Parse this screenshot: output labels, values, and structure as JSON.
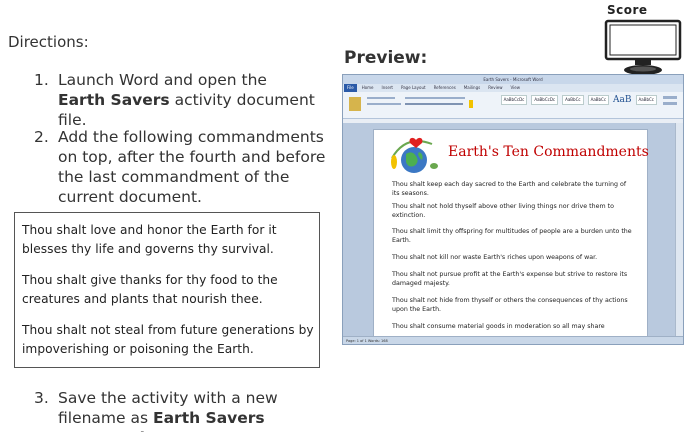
{
  "directions": {
    "title": "Directions:",
    "steps": [
      {
        "num": "1.",
        "pre": "Launch Word and open the ",
        "bold": "Earth Savers",
        "post": " activity document file."
      },
      {
        "num": "2.",
        "text": "Add the following commandments on top, after the fourth and before the last commandment of the current document."
      },
      {
        "num": "3.",
        "pre": "Save the activity with a new filename as ",
        "bold": "Earth Savers Commandments",
        "post": "."
      }
    ]
  },
  "commandments": [
    "Thou shalt love and honor the Earth for it blesses thy life and governs thy survival.",
    "Thou shalt give thanks for thy food to the creatures and plants that nourish thee.",
    "Thou shalt not steal from future generations by impoverishing or poisoning the Earth."
  ],
  "preview": {
    "title": "Preview:",
    "window_title": "Earth Savers - Microsoft Word",
    "menu_tabs": [
      "File",
      "Home",
      "Insert",
      "Page Layout",
      "References",
      "Mailings",
      "Review",
      "View"
    ],
    "style_samples": [
      "AaBbCcDc",
      "AaBbCcDc",
      "AaBbCc",
      "AaBbCc",
      "AaB",
      "AaBbCc"
    ],
    "doc_title": "Earth's Ten Commandments",
    "doc_lines": [
      "Thou shalt keep each day sacred to the Earth and celebrate the turning of its seasons.",
      "Thou shalt not hold thyself above other living things nor drive them to extinction.",
      "Thou shalt limit thy offspring for multitudes of people are a burden unto the Earth.",
      "Thou shalt not kill nor waste Earth's riches upon weapons of war.",
      "Thou shalt not pursue profit at the Earth's expense but strive to restore its damaged majesty.",
      "Thou shalt not hide from thyself or others the consequences of thy actions upon the Earth.",
      "Thou shalt consume material goods in moderation so all may share"
    ],
    "status": "Page: 1 of 1   Words: 168"
  },
  "score": {
    "label": "Score"
  },
  "colors": {
    "heading_red": "#c00000",
    "ribbon_blue": "#2a5aa8"
  }
}
